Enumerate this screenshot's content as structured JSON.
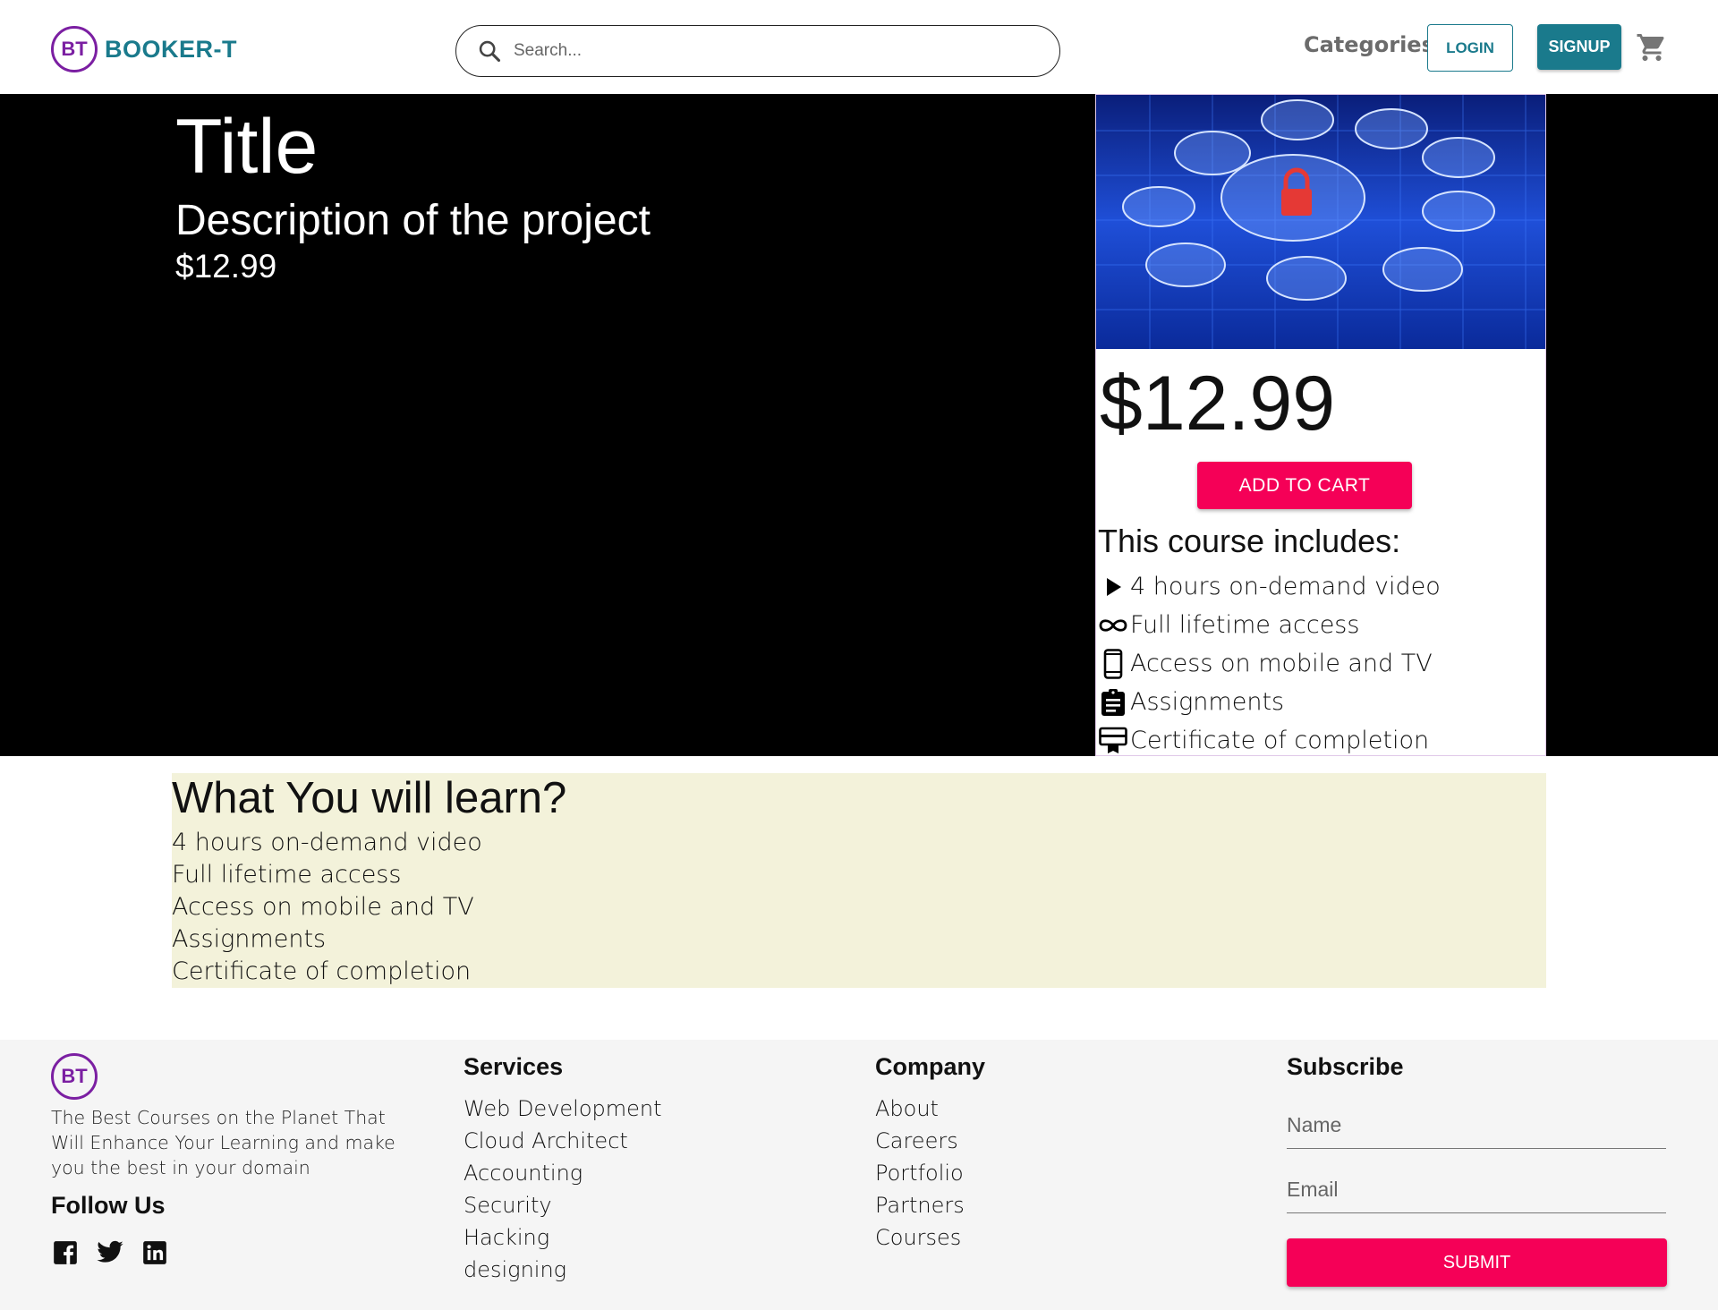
{
  "header": {
    "logo_mark": "BT",
    "brand": "BOOKER-T",
    "search_placeholder": "Search...",
    "categories": "Categories",
    "login": "LOGIN",
    "signup": "SIGNUP",
    "cart_icon": "shopping-cart-icon",
    "accent_color": "#1a7a8c",
    "logo_color": "#7b1fa2"
  },
  "hero": {
    "title": "Title",
    "description": "Description of the project",
    "price": "$12.99"
  },
  "card": {
    "price": "$12.99",
    "add_to_cart": "ADD TO CART",
    "includes_title": "This course includes:",
    "includes": [
      {
        "icon": "play-icon",
        "label": "4 hours on-demand video"
      },
      {
        "icon": "infinity-icon",
        "label": "Full lifetime access"
      },
      {
        "icon": "mobile-icon",
        "label": "Access on mobile and TV"
      },
      {
        "icon": "assignment-icon",
        "label": "Assignments"
      },
      {
        "icon": "certificate-icon",
        "label": "Certificate of completion"
      }
    ],
    "button_color": "#f50057"
  },
  "learn": {
    "title": "What You will learn?",
    "items": [
      "4 hours on-demand video",
      "Full lifetime access",
      "Access on mobile and TV",
      "Assignments",
      "Certificate of completion"
    ]
  },
  "footer": {
    "logo_mark": "BT",
    "about": "The Best Courses on the Planet That Will Enhance Your Learning and make you the best in your domain",
    "follow_us": "Follow Us",
    "social_icons": [
      "facebook-icon",
      "twitter-icon",
      "linkedin-icon"
    ],
    "services": {
      "title": "Services",
      "links": [
        "Web Development",
        "Cloud Architect",
        "Accounting",
        "Security",
        "Hacking",
        "designing"
      ]
    },
    "company": {
      "title": "Company",
      "links": [
        "About",
        "Careers",
        "Portfolio",
        "Partners",
        "Courses"
      ]
    },
    "subscribe": {
      "title": "Subscribe",
      "name_placeholder": "Name",
      "email_placeholder": "Email",
      "submit": "SUBMIT"
    }
  }
}
